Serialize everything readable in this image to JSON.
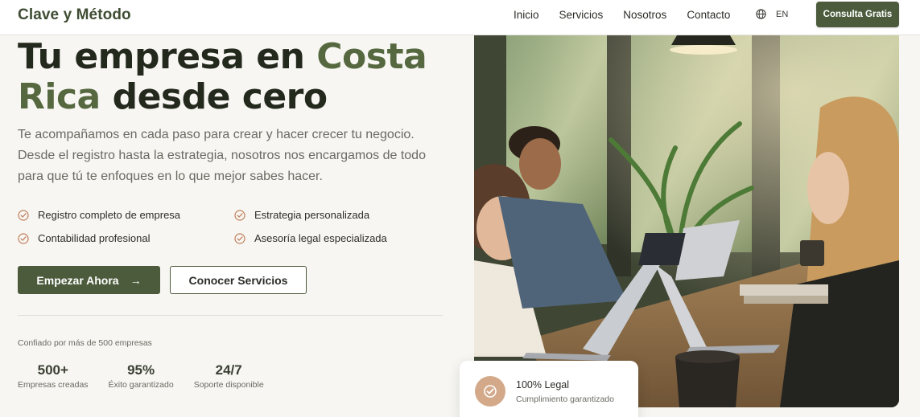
{
  "header": {
    "brand": "Clave y Método",
    "nav": [
      "Inicio",
      "Servicios",
      "Nosotros",
      "Contacto"
    ],
    "language": "EN",
    "cta": "Consulta Gratis"
  },
  "hero": {
    "title_part1": "Tu empresa en ",
    "title_accent": "Costa Rica",
    "title_part2": " desde cero",
    "description": "Te acompañamos en cada paso para crear y hacer crecer tu negocio. Desde el registro hasta la estrategia, nosotros nos encargamos de todo para que tú te enfoques en lo que mejor sabes hacer.",
    "features": [
      "Registro completo de empresa",
      "Estrategia personalizada",
      "Contabilidad profesional",
      "Asesoría legal especializada"
    ],
    "primary_button": "Empezar Ahora",
    "primary_arrow": "→",
    "secondary_button": "Conocer Servicios",
    "trusted_text": "Confiado por más de 500 empresas",
    "stats": [
      {
        "value": "500+",
        "label": "Empresas creadas"
      },
      {
        "value": "95%",
        "label": "Éxito garantizado"
      },
      {
        "value": "24/7",
        "label": "Soporte disponible"
      }
    ]
  },
  "badge": {
    "title": "100% Legal",
    "subtitle": "Cumplimiento garantizado"
  },
  "colors": {
    "primary": "#4b5b3c",
    "accent": "#55683f",
    "badge": "#d3a98a",
    "check": "#c07f5c"
  },
  "icons": {
    "language": "globe-icon",
    "feature": "check-circle-icon",
    "arrow": "arrow-right-icon",
    "badge": "check-badge-icon"
  }
}
